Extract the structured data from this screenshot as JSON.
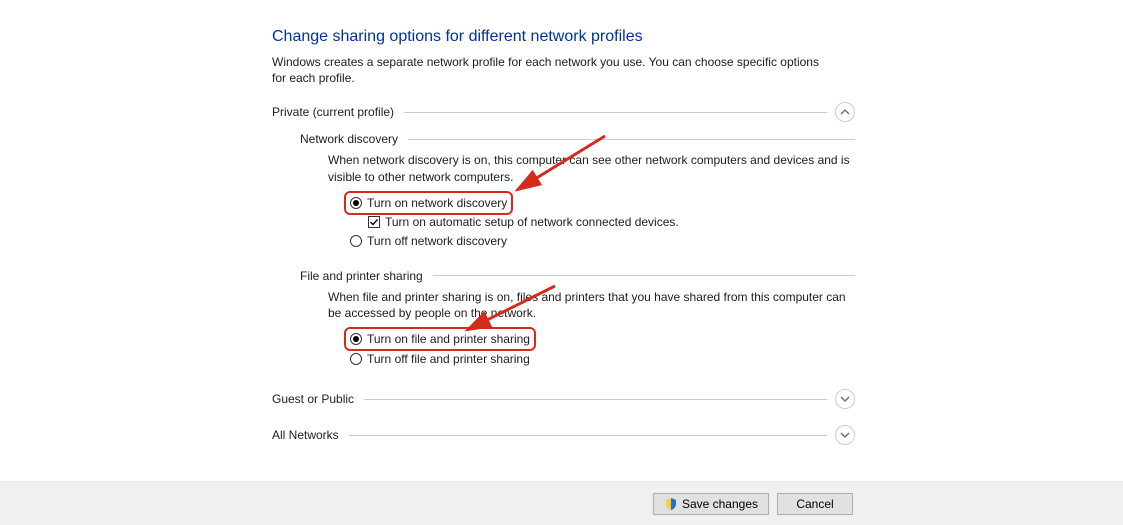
{
  "title": "Change sharing options for different network profiles",
  "description": "Windows creates a separate network profile for each network you use. You can choose specific options for each profile.",
  "profiles": {
    "private": {
      "label": "Private (current profile)",
      "network_discovery": {
        "heading": "Network discovery",
        "body": "When network discovery is on, this computer can see other network computers and devices and is visible to other network computers.",
        "on_label": "Turn on network discovery",
        "auto_label": "Turn on automatic setup of network connected devices.",
        "off_label": "Turn off network discovery"
      },
      "file_printer": {
        "heading": "File and printer sharing",
        "body": "When file and printer sharing is on, files and printers that you have shared from this computer can be accessed by people on the network.",
        "on_label": "Turn on file and printer sharing",
        "off_label": "Turn off file and printer sharing"
      }
    },
    "guest_label": "Guest or Public",
    "all_networks_label": "All Networks"
  },
  "buttons": {
    "save": "Save changes",
    "cancel": "Cancel"
  }
}
